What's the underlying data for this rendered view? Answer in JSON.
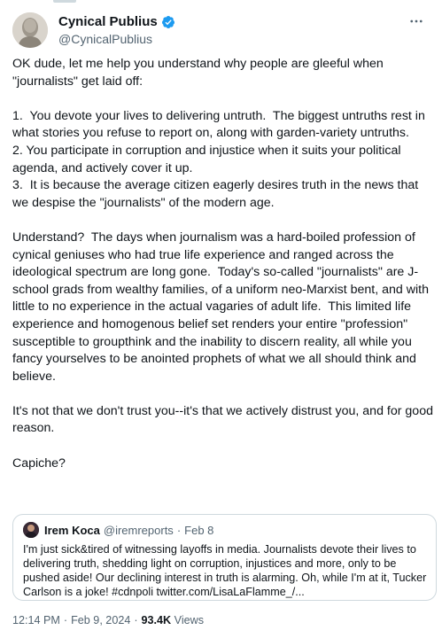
{
  "author": {
    "display_name": "Cynical Publius",
    "handle": "@CynicalPublius",
    "verified_icon": "verified-badge-icon",
    "accent": "#1d9bf0"
  },
  "more_icon": "more-horizontal-icon",
  "tweet": {
    "paragraphs": [
      "OK dude, let me help you understand why people are gleeful when \"journalists\" get laid off:",
      "",
      "1.  You devote your lives to delivering untruth.  The biggest untruths rest in what stories you refuse to report on, along with garden-variety untruths.",
      "2. You participate in corruption and injustice when it suits your political agenda, and actively cover it up.",
      "3.  It is because the average citizen eagerly desires truth in the news that we despise the \"journalists\" of the modern age.",
      "",
      "Understand?  The days when journalism was a hard-boiled profession of cynical geniuses who had true life experience and ranged across the ideological spectrum are long gone.  Today's so-called \"journalists\" are J-school grads from wealthy families, of a uniform neo-Marxist bent, and with little to no experience in the actual vagaries of adult life.  This limited life experience and homogenous belief set renders your entire \"profession\" susceptible to groupthink and the inability to discern reality, all while you fancy yourselves to be anointed prophets of what we all should think and believe.",
      "",
      "It's not that we don't trust you--it's that we actively distrust you, and for good reason.",
      "",
      "Capiche?"
    ]
  },
  "quote": {
    "display_name": "Irem Koca",
    "handle": "@iremreports",
    "separator": "·",
    "date": "Feb 8",
    "text": "I'm just sick&tired of witnessing layoffs in media. Journalists devote their lives to delivering truth, shedding light on corruption, injustices and more, only to be pushed aside! Our declining interest in truth is alarming. Oh, while I'm at it, Tucker Carlson is a joke! #cdnpoli twitter.com/LisaLaFlamme_/..."
  },
  "footer": {
    "time": "12:14 PM",
    "separator": "·",
    "date": "Feb 9, 2024",
    "views_count": "93.4K",
    "views_label": "Views"
  }
}
